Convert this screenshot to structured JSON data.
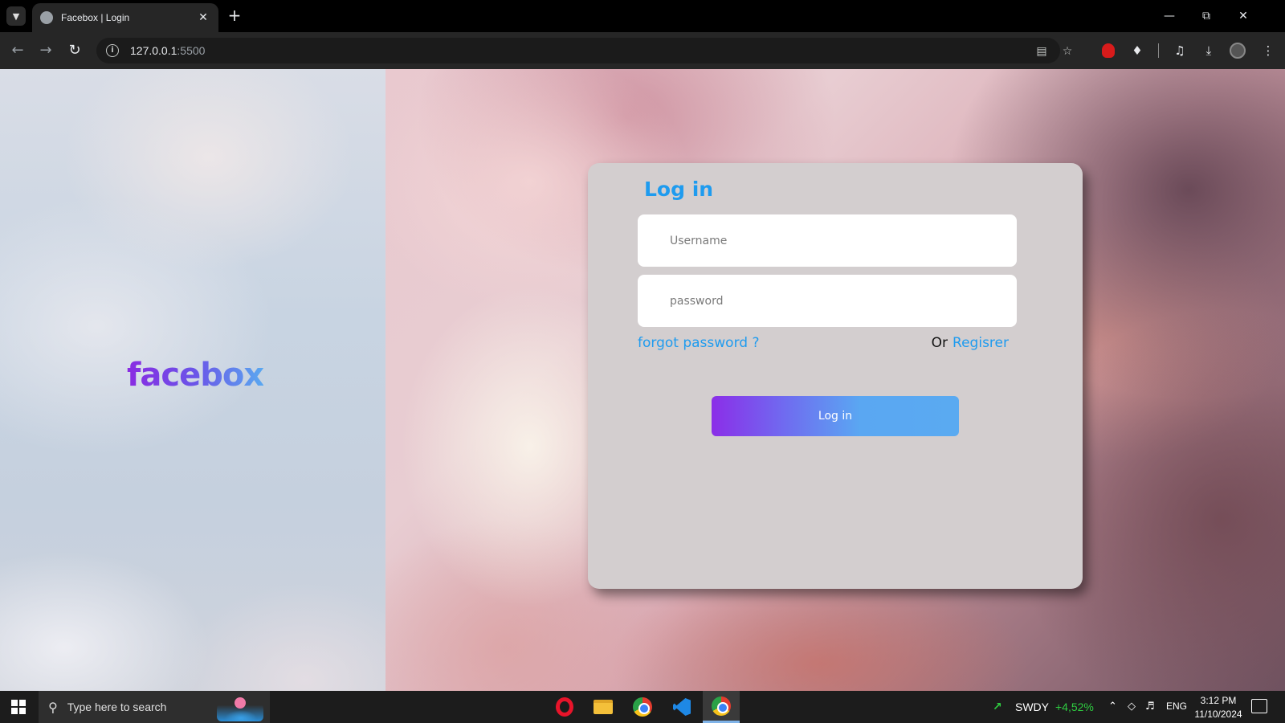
{
  "browser": {
    "tab_title": "Facebox | Login",
    "url_host": "127.0.0.1",
    "url_port": ":5500"
  },
  "page": {
    "brand": "facebox",
    "login": {
      "title": "Log in",
      "username_placeholder": "Username",
      "password_placeholder": "password",
      "forgot_label": "forgot password ?",
      "or_label": "Or",
      "register_label": "Regisrer",
      "submit_label": "Log in"
    }
  },
  "taskbar": {
    "search_placeholder": "Type here to search",
    "stock_name": "SWDY",
    "stock_change": "+4,52%",
    "language": "ENG",
    "time": "3:12 PM",
    "date": "11/10/2024"
  },
  "colors": {
    "accent_blue": "#1e9bef",
    "brand_purple": "#8a2be2",
    "card_bg": "#d3cecf"
  }
}
